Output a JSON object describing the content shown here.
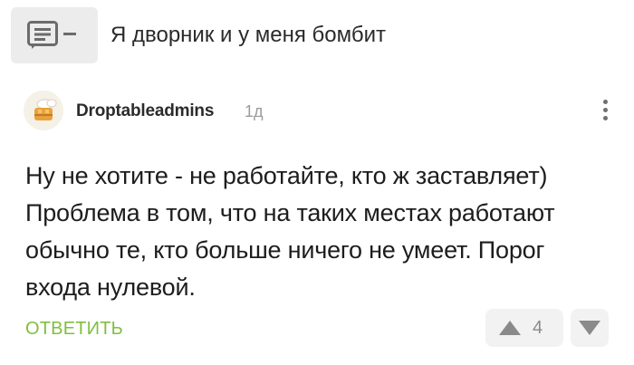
{
  "post": {
    "title": "Я дворник и у меня бомбит",
    "thumb_icon": "text-post-icon"
  },
  "comment": {
    "username": "Droptableadmins",
    "time": "1д",
    "avatar_icon": "avatar-image",
    "more_icon": "more-vertical-icon",
    "body_lines": [
      "Ну не хотите - не работайте, кто ж заставляет)",
      "Проблема в том, что на таких местах работают обычно те, кто больше ничего не умеет. Порог входа нулевой."
    ],
    "reply_label": "ОТВЕТИТЬ",
    "rating": "4",
    "upvote_icon": "triangle-up-icon",
    "downvote_icon": "triangle-down-icon"
  },
  "colors": {
    "accent_green": "#7fbf3d",
    "vote_bg": "#f2f2f2",
    "thumb_bg": "#ececec"
  }
}
